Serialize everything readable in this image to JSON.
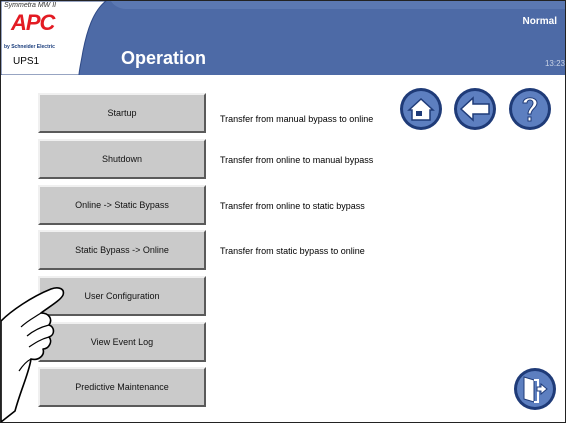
{
  "header": {
    "brand_line": "Symmetra MW II",
    "logo": "APC",
    "logo_byline": "by Schneider Electric",
    "ups_name": "UPS1",
    "title": "Operation",
    "status": "Normal",
    "clock": "13:23",
    "colors": {
      "bar": "#4d6aa6",
      "bar_dark": "#2f4a86",
      "logo_red": "#e31b23"
    }
  },
  "menu": {
    "buttons": [
      {
        "label": "Startup",
        "description": "Transfer from manual bypass to online"
      },
      {
        "label": "Shutdown",
        "description": "Transfer from online to manual bypass"
      },
      {
        "label": "Online -> Static Bypass",
        "description": "Transfer from online to static bypass"
      },
      {
        "label": "Static Bypass -> Online",
        "description": "Transfer from static bypass to online"
      },
      {
        "label": "User Configuration",
        "description": ""
      },
      {
        "label": "View Event Log",
        "description": ""
      },
      {
        "label": "Predictive Maintenance",
        "description": ""
      }
    ]
  },
  "nav": {
    "home_icon": "home-icon",
    "back_icon": "back-arrow-icon",
    "help_icon": "help-icon",
    "exit_icon": "exit-door-icon"
  },
  "overlay": {
    "pointer": "pointing-hand-icon"
  }
}
